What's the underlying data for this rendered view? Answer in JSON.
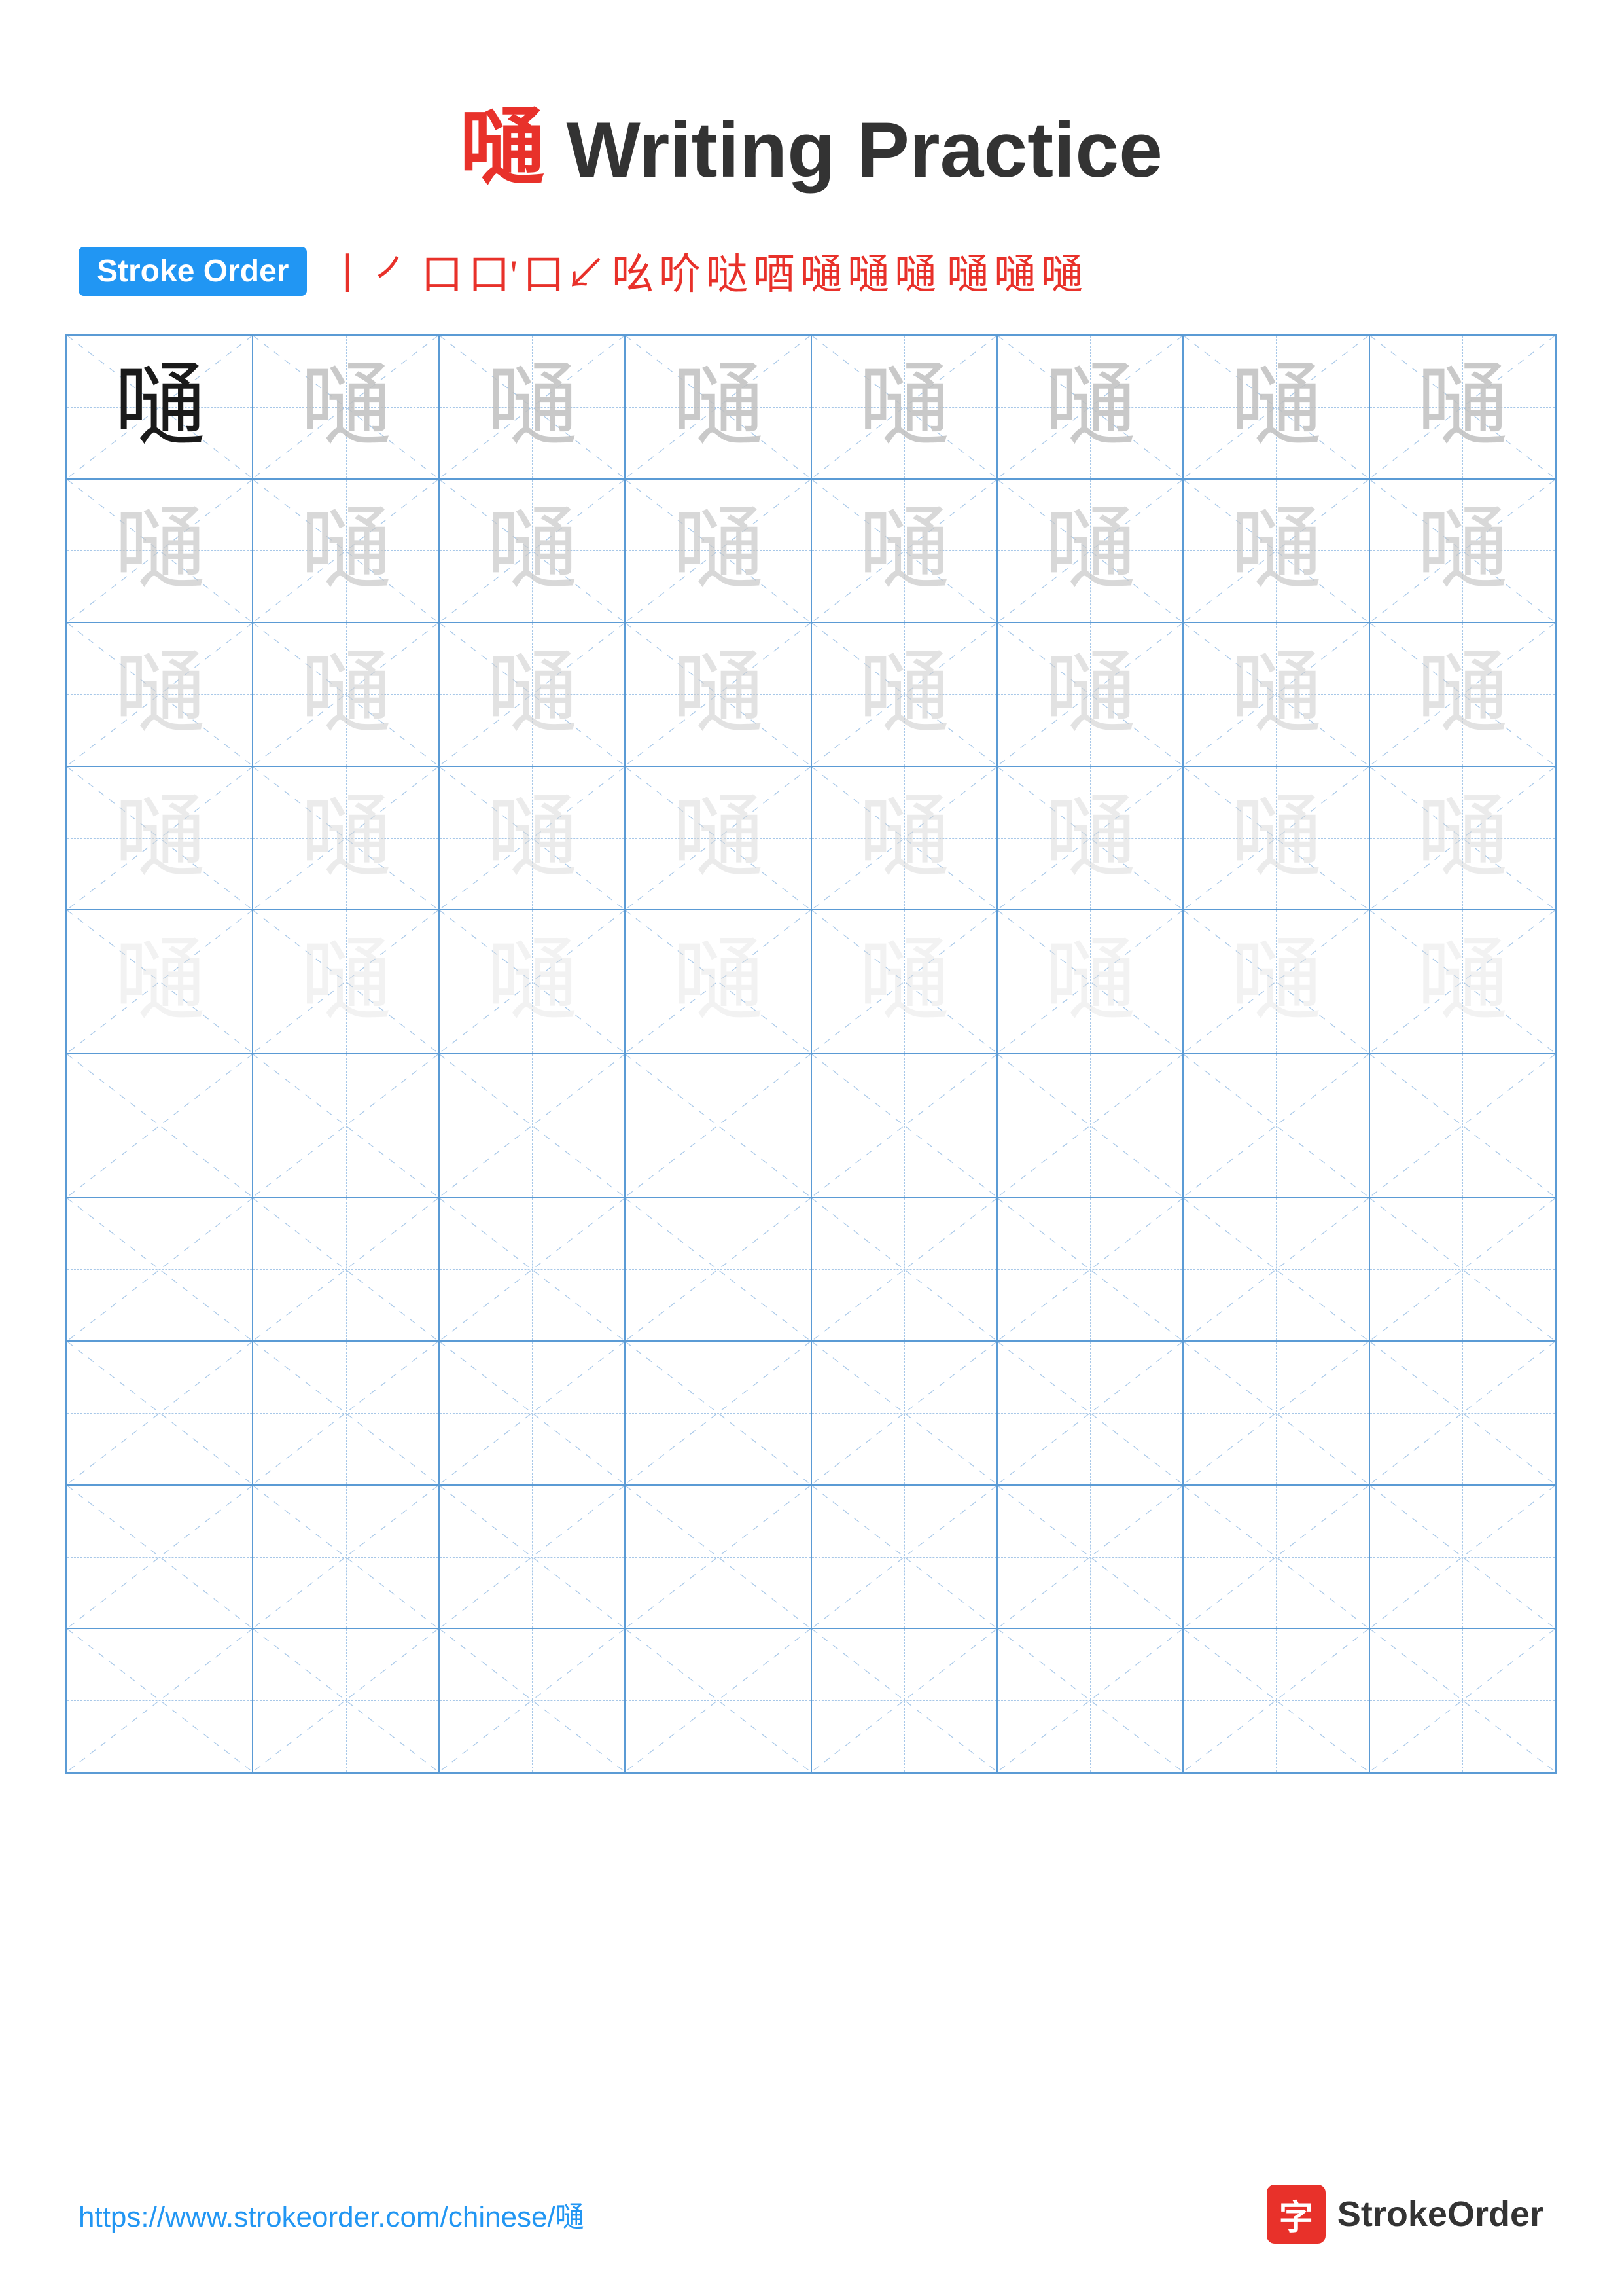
{
  "title": {
    "char": "嗵",
    "text": " Writing Practice"
  },
  "stroke_order": {
    "badge_label": "Stroke Order",
    "strokes": [
      "丨",
      "㇒",
      "口",
      "口'",
      "口↗",
      "吆",
      "吤",
      "哒",
      "唒",
      "嗵̶",
      "嗵̶̶",
      "嗵̶̶̶",
      "嗵̶̶̶̶",
      "嗵",
      "嗵",
      "嗵"
    ]
  },
  "grid": {
    "rows": 10,
    "cols": 8,
    "char": "嗵"
  },
  "footer": {
    "url": "https://www.strokeorder.com/chinese/嗵",
    "logo_icon": "字",
    "logo_text": "StrokeOrder"
  }
}
